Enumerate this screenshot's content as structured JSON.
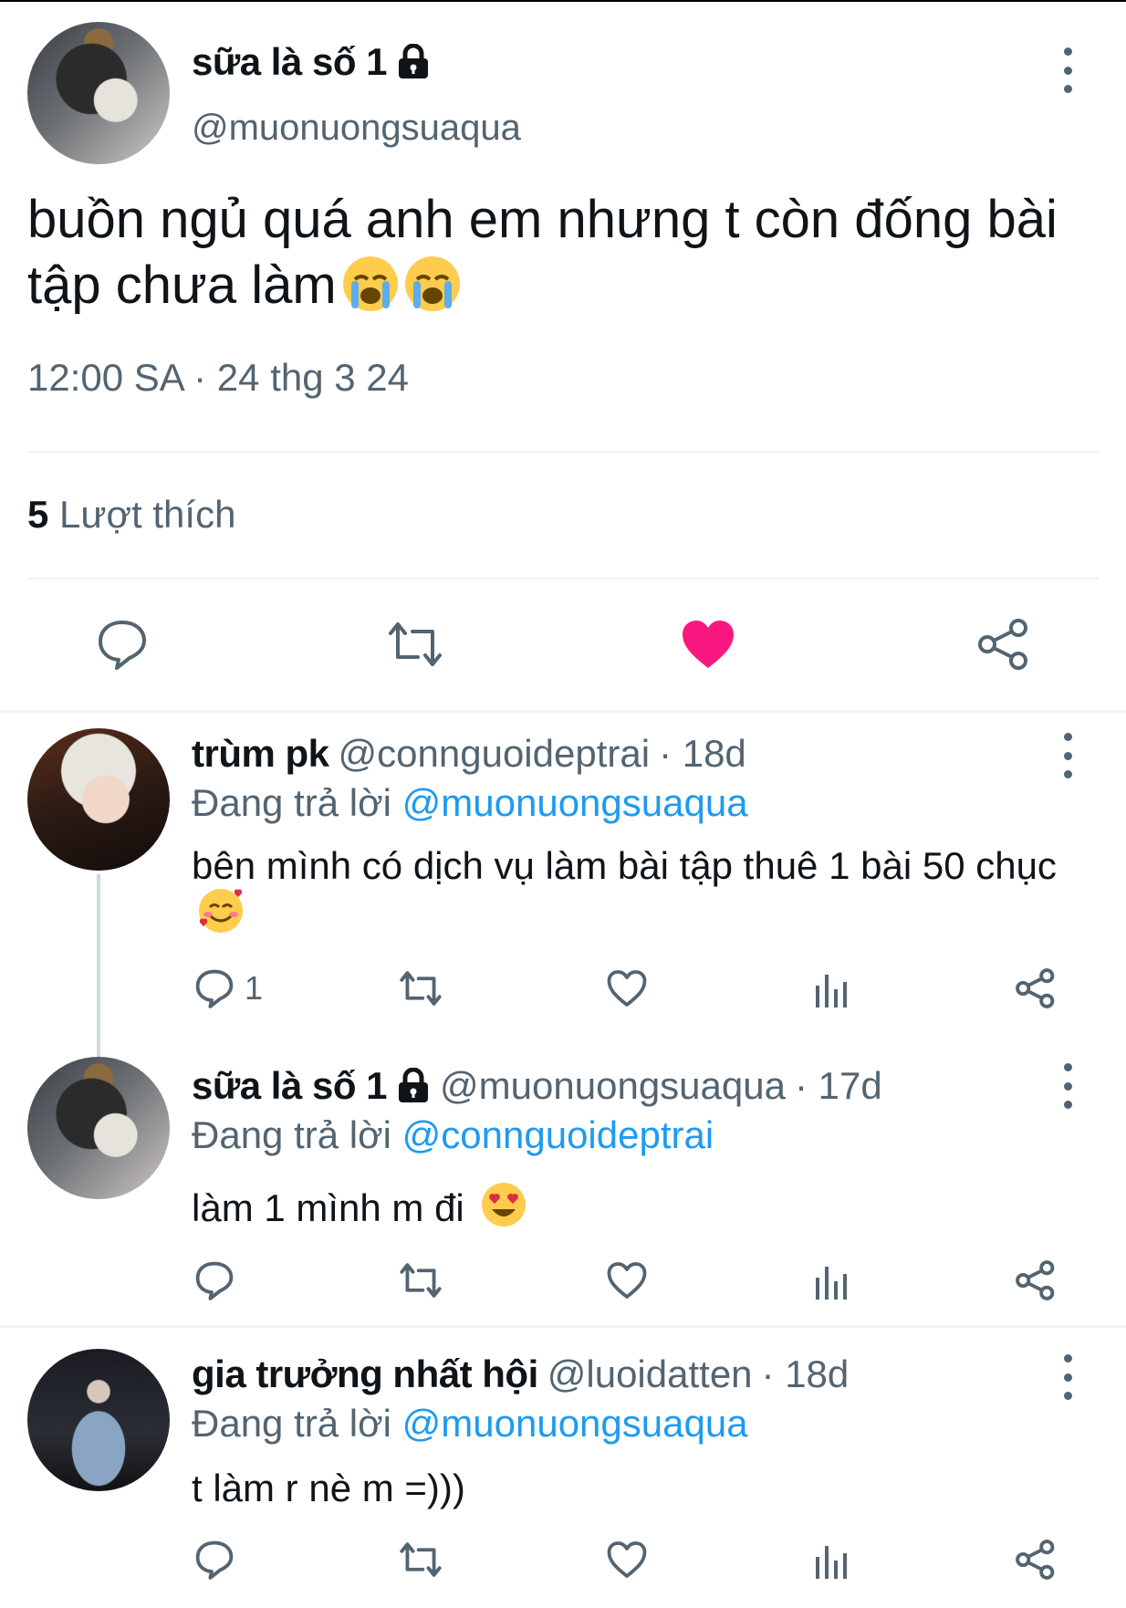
{
  "main_tweet": {
    "display_name": "sữa là số 1",
    "handle": "@muonuongsuaqua",
    "text": "buồn ngủ quá anh em nhưng t còn đống bài tập chưa làm",
    "emojis": [
      "loudly-crying-face",
      "loudly-crying-face"
    ],
    "timestamp": "12:00 SA · 24 thg 3 24",
    "likes_count": "5",
    "likes_label": "Lượt thích",
    "liked": true,
    "accent_color": "#f91880"
  },
  "replies": [
    {
      "display_name": "trùm pk",
      "handle": "@connguoideptrai",
      "age": "· 18d",
      "replying_label": "Đang trả lời",
      "replying_to": "@muonuongsuaqua",
      "text": "bên mình có dịch vụ làm bài tập thuê 1 bài 50 chục",
      "emoji": "smiling-face-with-hearts",
      "reply_count": "1"
    },
    {
      "display_name": "sữa là số 1",
      "handle": "@muonuongsuaqua",
      "age": "· 17d",
      "replying_label": "Đang trả lời",
      "replying_to": "@connguoideptrai",
      "text": "làm 1 mình m đi",
      "emoji": "smiling-face-with-heart-eyes",
      "reply_count": ""
    },
    {
      "display_name": "gia trưởng nhất hội",
      "handle": "@luoidatten",
      "age": "· 18d",
      "replying_label": "Đang trả lời",
      "replying_to": "@muonuongsuaqua",
      "text": "t làm r nè m =)))",
      "emoji": "",
      "reply_count": ""
    }
  ],
  "colors": {
    "text": "#0f1419",
    "muted": "#536471",
    "link": "#1d9bf0",
    "like": "#f91880"
  }
}
